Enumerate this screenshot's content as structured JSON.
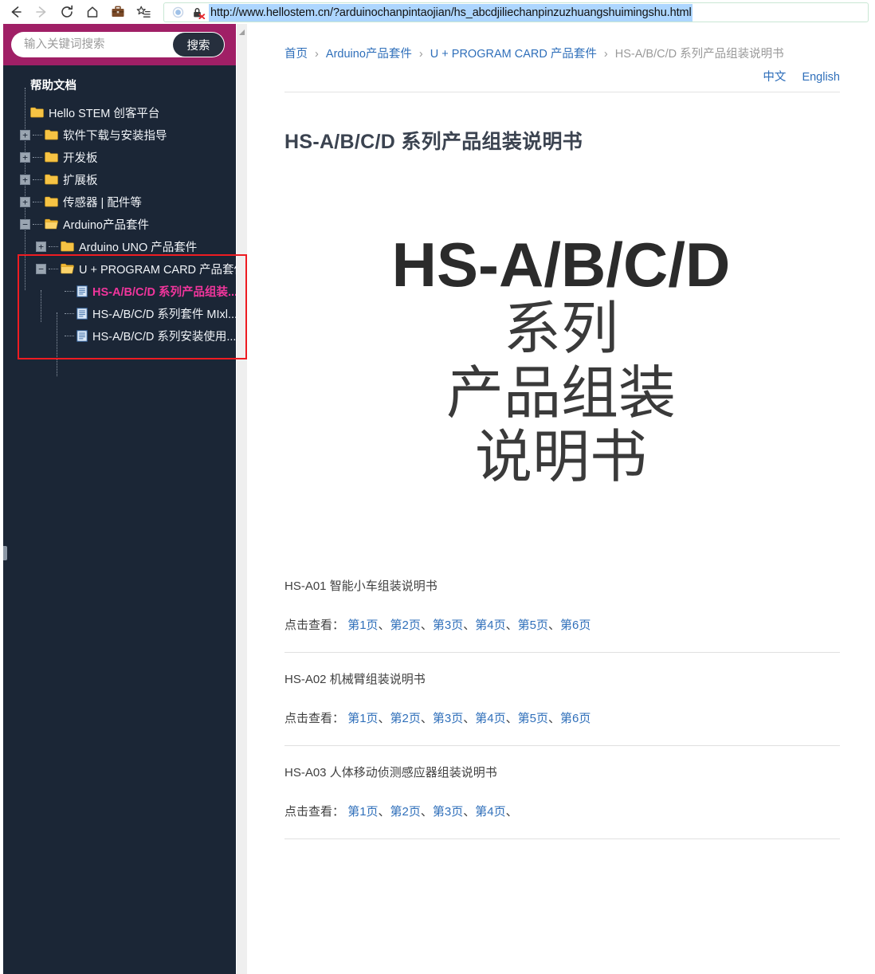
{
  "browser": {
    "nav": [
      {
        "name": "back-button",
        "glyph": "←",
        "enabled": true
      },
      {
        "name": "forward-button",
        "glyph": "→",
        "enabled": false
      },
      {
        "name": "reload-button",
        "glyph": "⟳",
        "enabled": true
      },
      {
        "name": "home-button",
        "glyph": "⌂",
        "enabled": true
      },
      {
        "name": "collections-button",
        "glyph": "briefcase",
        "enabled": true
      },
      {
        "name": "favorites-button",
        "glyph": "star-list",
        "enabled": true
      }
    ],
    "omnibox": {
      "url": "http://www.hellostem.cn/?arduinochanpintaojian/hs_abcdjiliechanpinzuzhuangshuimingshu.html",
      "security_icon": "broken-lock-icon",
      "info_icon": "page-info-icon",
      "selection_color": "#add6ff"
    }
  },
  "sidebar": {
    "accent_color": "#a01f66",
    "background_color": "#1b2636",
    "search": {
      "placeholder": "输入关键词搜索",
      "value": "",
      "button_label": "搜索"
    },
    "tree_title": "帮助文档",
    "nodes": [
      {
        "label": "Hello STEM 创客平台",
        "depth": 0,
        "type": "folder",
        "state": "leaf",
        "active": false
      },
      {
        "label": "软件下载与安装指导",
        "depth": 0,
        "type": "folder",
        "state": "collapsed",
        "active": false
      },
      {
        "label": "开发板",
        "depth": 0,
        "type": "folder",
        "state": "collapsed",
        "active": false
      },
      {
        "label": "扩展板",
        "depth": 0,
        "type": "folder",
        "state": "collapsed",
        "active": false
      },
      {
        "label": "传感器 | 配件等",
        "depth": 0,
        "type": "folder",
        "state": "collapsed",
        "active": false
      },
      {
        "label": "Arduino产品套件",
        "depth": 0,
        "type": "folder",
        "state": "expanded",
        "active": false
      },
      {
        "label": "Arduino UNO 产品套件",
        "depth": 1,
        "type": "folder",
        "state": "collapsed",
        "active": false
      },
      {
        "label": "U + PROGRAM CARD 产品套件",
        "depth": 1,
        "type": "folder",
        "state": "expanded",
        "active": false
      },
      {
        "label": "HS-A/B/C/D 系列产品组装...",
        "depth": 2,
        "type": "document",
        "state": "leaf",
        "active": true
      },
      {
        "label": "HS-A/B/C/D 系列套件 MIxl...",
        "depth": 2,
        "type": "document",
        "state": "leaf",
        "active": false
      },
      {
        "label": "HS-A/B/C/D 系列安装使用...",
        "depth": 2,
        "type": "document",
        "state": "leaf",
        "active": false
      }
    ],
    "annotation_color": "#ee1c22"
  },
  "content": {
    "breadcrumb": [
      {
        "label": "首页",
        "link": true
      },
      {
        "label": "Arduino产品套件",
        "link": true
      },
      {
        "label": "U + PROGRAM CARD 产品套件",
        "link": true
      },
      {
        "label": "HS-A/B/C/D 系列产品组装说明书",
        "link": false
      }
    ],
    "breadcrumb_separator": "›",
    "languages": [
      {
        "label": "中文"
      },
      {
        "label": "English"
      }
    ],
    "page_title": "HS-A/B/C/D 系列产品组装说明书",
    "hero": {
      "line1": "HS-A/B/C/D",
      "line2": "系列",
      "line3": "产品组装",
      "line4": "说明书"
    },
    "link_prefix": "点击查看：",
    "sections": [
      {
        "title": "HS-A01 智能小车组装说明书",
        "pages": [
          "第1页",
          "第2页",
          "第3页",
          "第4页",
          "第5页",
          "第6页"
        ],
        "separator": "、",
        "trailing_separator": false
      },
      {
        "title": "HS-A02 机械臂组装说明书",
        "pages": [
          "第1页",
          "第2页",
          "第3页",
          "第4页",
          "第5页",
          "第6页"
        ],
        "separator": "、",
        "trailing_separator": false
      },
      {
        "title": "HS-A03 人体移动侦测感应器组装说明书",
        "pages": [
          "第1页",
          "第2页",
          "第3页",
          "第4页"
        ],
        "separator": "、",
        "trailing_separator": true
      }
    ]
  }
}
